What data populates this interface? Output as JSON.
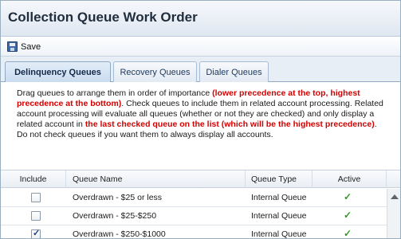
{
  "window": {
    "title": "Collection Queue Work Order"
  },
  "toolbar": {
    "save_label": "Save",
    "save_icon": "floppy-disk-icon"
  },
  "tabs": [
    {
      "label": "Delinquency Queues",
      "active": true
    },
    {
      "label": "Recovery Queues",
      "active": false
    },
    {
      "label": "Dialer Queues",
      "active": false
    }
  ],
  "instructions": {
    "part1": "Drag queues to arrange them in order of importance ",
    "part2_red": "(lower precedence at the top, highest precedence at the bottom)",
    "part3": ". Check queues to include them in related account processing. Related account processing will evaluate all queues (whether or not they are checked) and only display a related account in ",
    "part4_red": "the last checked queue on the list (which will be the highest precedence)",
    "part5": ". Do not check queues if you want them to always display all accounts."
  },
  "grid": {
    "columns": {
      "include": "Include",
      "queue_name": "Queue Name",
      "queue_type": "Queue Type",
      "active": "Active"
    },
    "rows": [
      {
        "include": false,
        "queue_name": "Overdrawn - $25 or less",
        "queue_type": "Internal Queue",
        "active": true
      },
      {
        "include": false,
        "queue_name": "Overdrawn - $25-$250",
        "queue_type": "Internal Queue",
        "active": true
      },
      {
        "include": true,
        "queue_name": "Overdrawn - $250-$1000",
        "queue_type": "Internal Queue",
        "active": true
      }
    ]
  },
  "colors": {
    "red_text": "#d40000",
    "active_check": "#2e9a1f",
    "tab_border": "#8fa8c4"
  }
}
